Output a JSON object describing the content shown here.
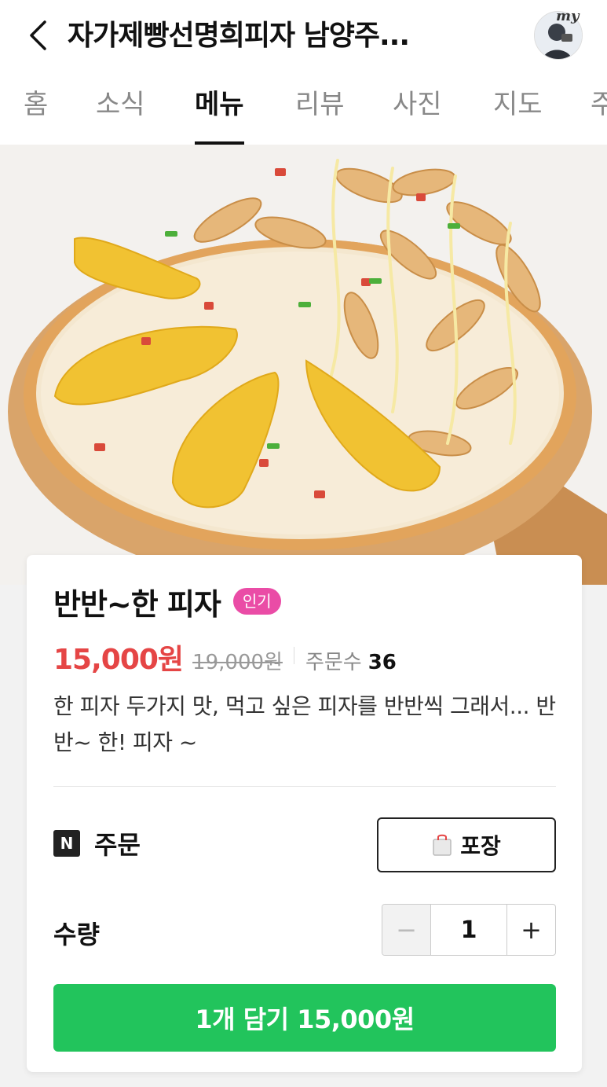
{
  "header": {
    "title": "자가제빵선명희피자 남양주...",
    "avatar_text": "my"
  },
  "tabs": [
    {
      "label": "홈"
    },
    {
      "label": "소식"
    },
    {
      "label": "메뉴"
    },
    {
      "label": "리뷰"
    },
    {
      "label": "사진"
    },
    {
      "label": "지도"
    },
    {
      "label": "주"
    }
  ],
  "active_tab": "메뉴",
  "product": {
    "name": "반반~한 피자",
    "badge": "인기",
    "price": "15,000원",
    "original_price": "19,000원",
    "order_count_label": "주문수",
    "order_count": "36",
    "description": "한 피자 두가지 맛, 먹고 싶은 피자를 반반씩 그래서... 반반~ 한! 피자 ~"
  },
  "order": {
    "n_logo": "N",
    "label": "주문",
    "pack_label": "포장"
  },
  "quantity": {
    "label": "수량",
    "value": "1",
    "minus": "−",
    "plus": "+"
  },
  "cart_button": "1개 담기 15,000원",
  "colors": {
    "price": "#e54545",
    "badge": "#ea4ca6",
    "cart_button": "#22c45c"
  }
}
